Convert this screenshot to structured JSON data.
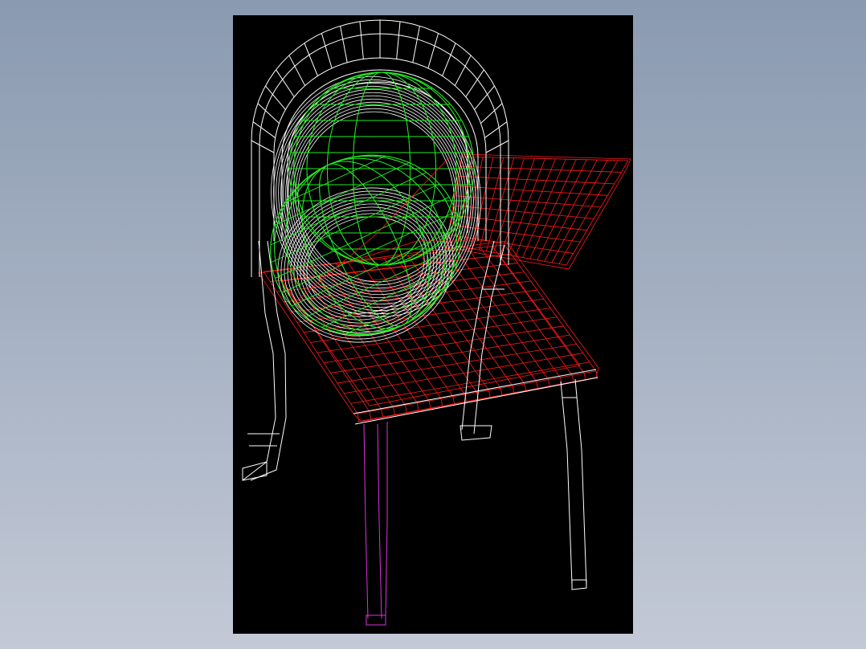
{
  "app": {
    "background_top": "#8a9ab0",
    "background_bottom": "#c3c9d6",
    "viewport_background": "#000000"
  },
  "model": {
    "subject": "chair-wireframe",
    "colors": {
      "frame": "#ffffff",
      "seat": "#ff1a1a",
      "cushion": "#22ee22",
      "leg_highlight": "#dd33dd"
    }
  }
}
